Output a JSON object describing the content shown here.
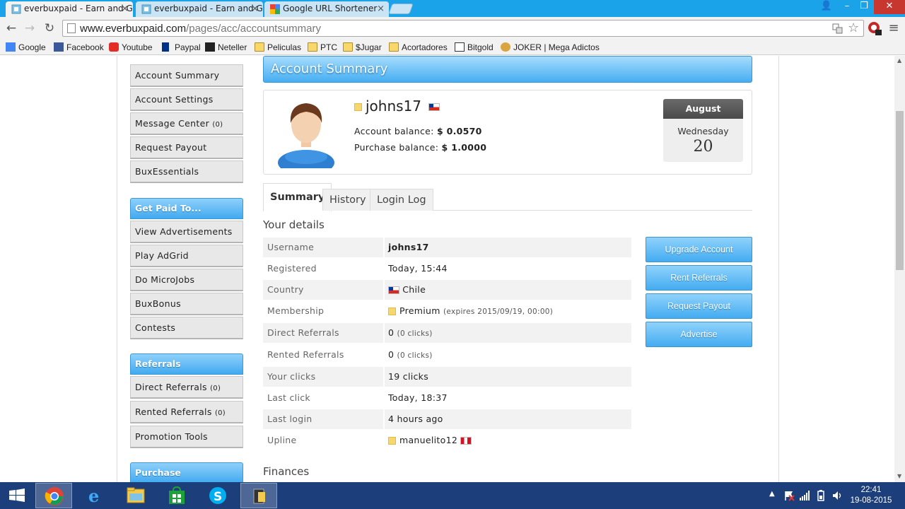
{
  "browser": {
    "tabs": [
      {
        "title": "everbuxpaid - Earn and Get",
        "close": "×"
      },
      {
        "title": "everbuxpaid - Earn and Get",
        "close": "×"
      },
      {
        "title": "Google URL Shortener",
        "close": "×"
      }
    ],
    "url_host": "www.everbuxpaid.com",
    "url_path": "/pages/acc/accountsummary",
    "window_controls": {
      "profile": "👤",
      "minimize": "–",
      "restore": "❐",
      "close": "✕"
    },
    "nav": {
      "back": "←",
      "forward": "→",
      "reload": "↻",
      "star": "☆",
      "menu": "≡"
    }
  },
  "bookmarks": [
    {
      "label": "Google",
      "icon": "google-icon",
      "color": "#4285f4"
    },
    {
      "label": "Facebook",
      "icon": "facebook-icon",
      "color": "#3b5998"
    },
    {
      "label": "Youtube",
      "icon": "youtube-icon",
      "color": "#e52d27"
    },
    {
      "label": "Paypal",
      "icon": "paypal-icon",
      "color": "#003087"
    },
    {
      "label": "Neteller",
      "icon": "neteller-icon",
      "color": "#222222"
    },
    {
      "label": "Peliculas",
      "icon": "folder-icon"
    },
    {
      "label": "PTC",
      "icon": "folder-icon"
    },
    {
      "label": "$Jugar",
      "icon": "folder-icon"
    },
    {
      "label": "Acortadores",
      "icon": "folder-icon"
    },
    {
      "label": "Bitgold",
      "icon": "bitgold-icon"
    },
    {
      "label": "JOKER | Mega Adictos",
      "icon": "joker-icon"
    }
  ],
  "sidebar": {
    "account_items": [
      {
        "label": "Account Summary",
        "count": ""
      },
      {
        "label": "Account Settings",
        "count": ""
      },
      {
        "label": "Message Center",
        "count": "(0)"
      },
      {
        "label": "Request Payout",
        "count": ""
      },
      {
        "label": "BuxEssentials",
        "count": ""
      }
    ],
    "get_paid_heading": "Get Paid To...",
    "get_paid_items": [
      {
        "label": "View Advertisements"
      },
      {
        "label": "Play AdGrid"
      },
      {
        "label": "Do MicroJobs"
      },
      {
        "label": "BuxBonus"
      },
      {
        "label": "Contests"
      }
    ],
    "referrals_heading": "Referrals",
    "referral_items": [
      {
        "label": "Direct Referrals",
        "count": "(0)"
      },
      {
        "label": "Rented Referrals",
        "count": "(0)"
      },
      {
        "label": "Promotion Tools",
        "count": ""
      }
    ],
    "purchase_heading": "Purchase"
  },
  "main": {
    "title": "Account Summary",
    "profile": {
      "username": "johns17",
      "account_balance_label": "Account balance:",
      "account_balance": "$ 0.0570",
      "purchase_balance_label": "Purchase balance:",
      "purchase_balance": "$ 1.0000"
    },
    "date": {
      "month": "August",
      "weekday": "Wednesday",
      "day": "20"
    },
    "tabs": [
      "Summary",
      "History",
      "Login Log"
    ],
    "details_title": "Your details",
    "details": {
      "username": {
        "label": "Username",
        "value": "johns17"
      },
      "registered": {
        "label": "Registered",
        "value": "Today, 15:44"
      },
      "country": {
        "label": "Country",
        "value": "Chile"
      },
      "membership": {
        "label": "Membership",
        "value": "Premium",
        "note": "(expires 2015/09/19, 00:00)"
      },
      "direct_referrals": {
        "label": "Direct Referrals",
        "value": "0",
        "note": "(0 clicks)"
      },
      "rented_referrals": {
        "label": "Rented Referrals",
        "value": "0",
        "note": "(0 clicks)"
      },
      "your_clicks": {
        "label": "Your clicks",
        "value": "19 clicks"
      },
      "last_click": {
        "label": "Last click",
        "value": "Today, 18:37"
      },
      "last_login": {
        "label": "Last login",
        "value": "4 hours ago"
      },
      "upline": {
        "label": "Upline",
        "value": "manuelito12"
      }
    },
    "actions": [
      "Upgrade Account",
      "Rent Referrals",
      "Request Payout",
      "Advertise"
    ],
    "finances_title": "Finances"
  },
  "taskbar": {
    "apps": [
      "start-icon",
      "chrome-icon",
      "internet-explorer-icon",
      "file-explorer-icon",
      "store-icon",
      "skype-icon",
      "media-app-icon"
    ],
    "time": "22:41",
    "date": "19-08-2015"
  },
  "colors": {
    "accent_blue": "#46aef2",
    "tab_strip": "#1aa3e8",
    "taskbar": "#1c3e7a",
    "premium_gold": "#f5d76e"
  }
}
